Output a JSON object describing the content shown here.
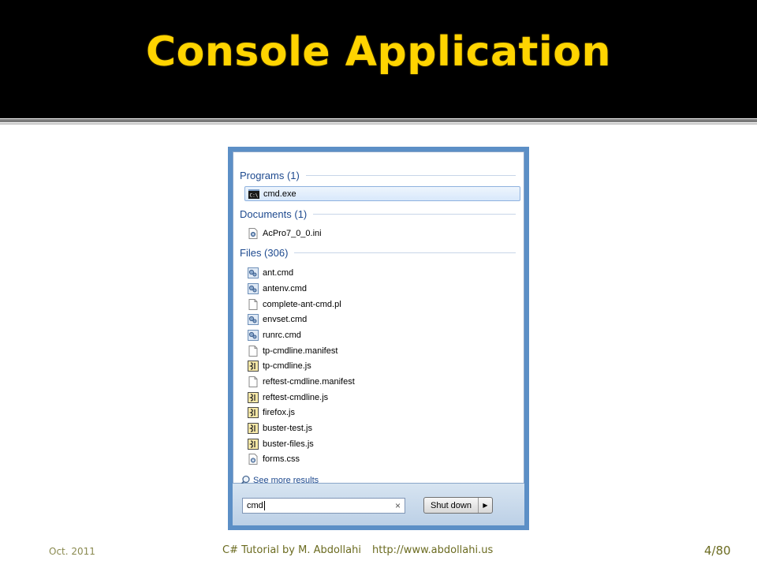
{
  "slide": {
    "title": "Console Application"
  },
  "start_menu": {
    "groups": [
      {
        "title": "Programs (1)",
        "items": [
          {
            "label": "cmd.exe",
            "icon": "console-app-icon",
            "selected": true
          }
        ]
      },
      {
        "title": "Documents (1)",
        "items": [
          {
            "label": "AcPro7_0_0.ini",
            "icon": "settings-file-icon",
            "selected": false
          }
        ]
      },
      {
        "title": "Files (306)",
        "items": [
          {
            "label": "ant.cmd",
            "icon": "batch-file-icon"
          },
          {
            "label": "antenv.cmd",
            "icon": "batch-file-icon"
          },
          {
            "label": "complete-ant-cmd.pl",
            "icon": "blank-file-icon"
          },
          {
            "label": "envset.cmd",
            "icon": "batch-file-icon"
          },
          {
            "label": "runrc.cmd",
            "icon": "batch-file-icon"
          },
          {
            "label": "tp-cmdline.manifest",
            "icon": "blank-file-icon"
          },
          {
            "label": "tp-cmdline.js",
            "icon": "script-file-icon"
          },
          {
            "label": "reftest-cmdline.manifest",
            "icon": "blank-file-icon"
          },
          {
            "label": "reftest-cmdline.js",
            "icon": "script-file-icon"
          },
          {
            "label": "firefox.js",
            "icon": "script-file-icon"
          },
          {
            "label": "buster-test.js",
            "icon": "script-file-icon"
          },
          {
            "label": "buster-files.js",
            "icon": "script-file-icon"
          },
          {
            "label": "forms.css",
            "icon": "css-file-icon"
          }
        ]
      }
    ],
    "see_more": "See more results",
    "search": {
      "value": "cmd",
      "clear": "×"
    },
    "shutdown_label": "Shut down",
    "shutdown_arrow": "▶"
  },
  "footer": {
    "date": "Oct. 2011",
    "course": "C# Tutorial by M. Abdollahi",
    "url": "http://www.abdollahi.us",
    "page": "4/80"
  },
  "colors": {
    "title": "#ffd400",
    "header_bg": "#000000",
    "group_title": "#1e4a8f",
    "frame": "#5c8fc6"
  }
}
